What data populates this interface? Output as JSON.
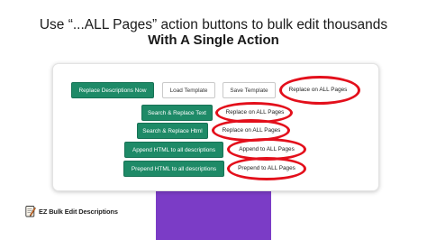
{
  "headline": {
    "line1": "Use “...ALL Pages” action buttons to bulk edit thousands",
    "line2": "With A Single Action"
  },
  "toolbar": {
    "replace_descriptions_now": "Replace Descriptions Now",
    "load_template": "Load Template",
    "save_template": "Save Template",
    "replace_all_pages_top": "Replace on ALL Pages"
  },
  "rows": {
    "search_replace_text": "Search & Replace Text",
    "replace_all_pages_text": "Replace on ALL Pages",
    "search_replace_html": "Search & Replace Html",
    "replace_all_pages_html": "Replace on ALL Pages",
    "append_html": "Append HTML to all descriptions",
    "append_all_pages": "Append to ALL Pages",
    "prepend_html": "Prepend HTML to all descriptions",
    "prepend_all_pages": "Prepend to ALL Pages"
  },
  "brand": {
    "name": "EZ Bulk Edit Descriptions",
    "logo_icon": "pencil-notepad-icon"
  },
  "colors": {
    "primary_green": "#1e8a67",
    "highlight_red": "#e30f1b",
    "accent_purple": "#7b3cc6"
  }
}
